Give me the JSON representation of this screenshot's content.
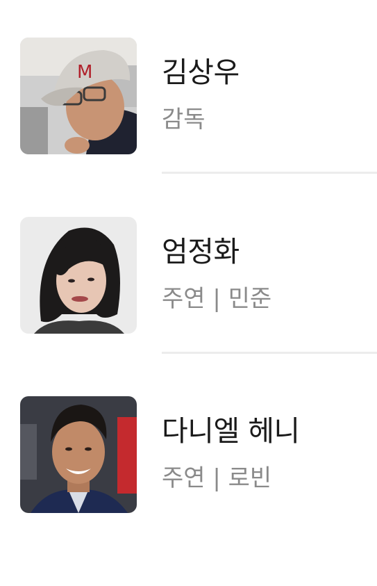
{
  "cast": [
    {
      "name": "김상우",
      "role": "감독"
    },
    {
      "name": "엄정화",
      "role": "주연 | 민준"
    },
    {
      "name": "다니엘 헤니",
      "role": "주연 | 로빈"
    }
  ]
}
